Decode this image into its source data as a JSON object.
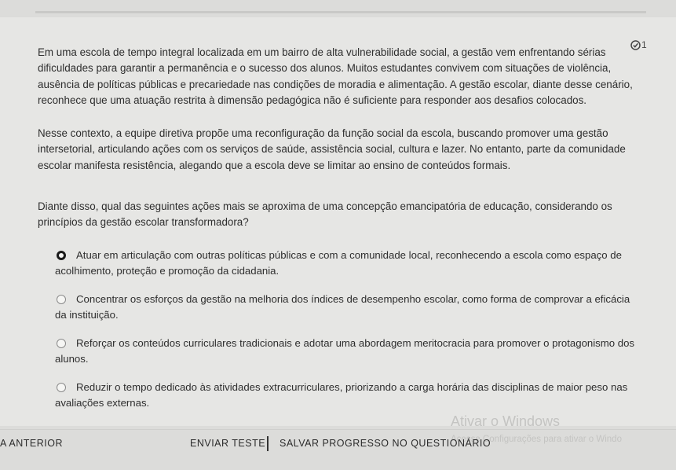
{
  "question": {
    "badge_count": "1",
    "paragraphs": [
      "Em uma escola de tempo integral localizada em um bairro de alta vulnerabilidade social, a gestão vem enfrentando sérias dificuldades para garantir a permanência e o sucesso dos alunos. Muitos estudantes convivem com situações de violência, ausência de políticas públicas e precariedade nas condições de moradia e alimentação. A gestão escolar, diante desse cenário, reconhece que uma atuação restrita à dimensão pedagógica não é suficiente para responder aos desafios colocados.",
      "Nesse contexto, a equipe diretiva propõe uma reconfiguração da função social da escola, buscando promover uma gestão intersetorial, articulando ações com os serviços de saúde, assistência social, cultura e lazer. No entanto, parte da comunidade escolar manifesta resistência, alegando que a escola deve se limitar ao ensino de conteúdos formais.",
      "Diante disso, qual das seguintes ações mais se aproxima de uma concepção emancipatória de educação, considerando os princípios da gestão escolar transformadora?"
    ]
  },
  "options": [
    {
      "text": "Atuar em articulação com outras políticas públicas e com a comunidade local, reconhecendo a escola como espaço de acolhimento, proteção e promoção da cidadania.",
      "selected": true
    },
    {
      "text": "Concentrar os esforços da gestão na melhoria dos índices de desempenho escolar, como forma de comprovar a eficácia da instituição.",
      "selected": false
    },
    {
      "text": "Reforçar os conteúdos curriculares tradicionais e adotar uma abordagem meritocracia para promover o protagonismo dos alunos.",
      "selected": false
    },
    {
      "text": "Reduzir o tempo dedicado às atividades extracurriculares, priorizando a carga horária das disciplinas de maior peso nas avaliações externas.",
      "selected": false
    }
  ],
  "footer": {
    "prev_label": "A ANTERIOR",
    "send_label": "ENVIAR TESTE",
    "save_label": "SALVAR PROGRESSO NO QUESTIONÁRIO"
  },
  "watermark": {
    "title": "Ativar o Windows",
    "subtitle": "Acesse Configurações para ativar o Windo"
  }
}
